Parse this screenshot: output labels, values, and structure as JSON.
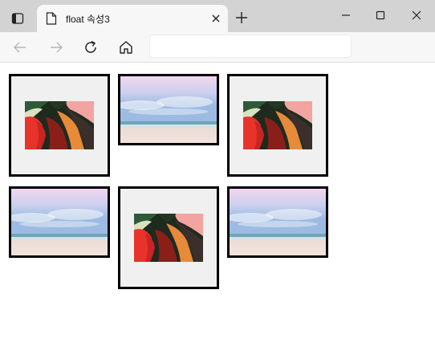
{
  "tab": {
    "title": "float 속성3"
  },
  "address": {
    "value": ""
  },
  "gallery": [
    {
      "kind": "abstract"
    },
    {
      "kind": "beach"
    },
    {
      "kind": "abstract"
    },
    {
      "kind": "beach"
    },
    {
      "kind": "abstract"
    },
    {
      "kind": "beach"
    }
  ],
  "colors": {
    "tab_strip": "#d3d3d3",
    "toolbar": "#f7f7f7",
    "frame_border": "#000000",
    "abstract_bg": "#f0f0f0"
  },
  "icons": [
    "tab-actions-icon",
    "page-icon",
    "close-icon",
    "plus-icon",
    "minimize-icon",
    "maximize-icon",
    "close-window-icon",
    "back-arrow-icon",
    "forward-arrow-icon",
    "refresh-icon",
    "home-icon"
  ]
}
